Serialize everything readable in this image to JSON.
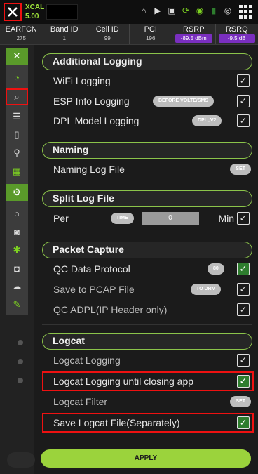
{
  "app": {
    "name": "XCAL",
    "version": "5.00"
  },
  "status_icons": [
    "sim-icon",
    "play-icon",
    "save-icon",
    "sync-icon",
    "gps-icon",
    "battery-icon",
    "record-icon",
    "apps-grid-icon"
  ],
  "info": [
    {
      "label": "EARFCN",
      "value": "275"
    },
    {
      "label": "Band ID",
      "value": "1"
    },
    {
      "label": "Cell ID",
      "value": "99"
    },
    {
      "label": "PCI",
      "value": "196"
    },
    {
      "label": "RSRP",
      "value": "-89.5 dBm"
    },
    {
      "label": "RSRQ",
      "value": "-9.5 dB"
    }
  ],
  "sections": {
    "additional_logging": {
      "title": "Additional Logging",
      "wifi": "WiFi Logging",
      "esp": "ESP Info Logging",
      "esp_option": "BEFORE VOLTE/SMS",
      "dpl": "DPL Model Logging",
      "dpl_option": "DPL_V2"
    },
    "naming": {
      "title": "Naming",
      "log_file": "Naming Log File",
      "set": "SET"
    },
    "split": {
      "title": "Split Log File",
      "per": "Per",
      "mode": "TIME",
      "value": "0",
      "unit": "Min"
    },
    "packet": {
      "title": "Packet Capture",
      "qc": "QC Data Protocol",
      "qc_option": "80",
      "pcap": "Save to PCAP File",
      "pcap_option": "TO DRM",
      "adpl": "QC ADPL(IP Header only)"
    },
    "logcat": {
      "title": "Logcat",
      "logging": "Logcat Logging",
      "until_close": "Logcat Logging until closing app",
      "filter": "Logcat Filter",
      "filter_set": "SET",
      "save_sep": "Save Logcat File(Separately)"
    }
  },
  "apply": "APPLY",
  "colors": {
    "accent": "#8bc34a",
    "highlight": "#e11111",
    "rsrp_bg": "#7a2fbf"
  }
}
